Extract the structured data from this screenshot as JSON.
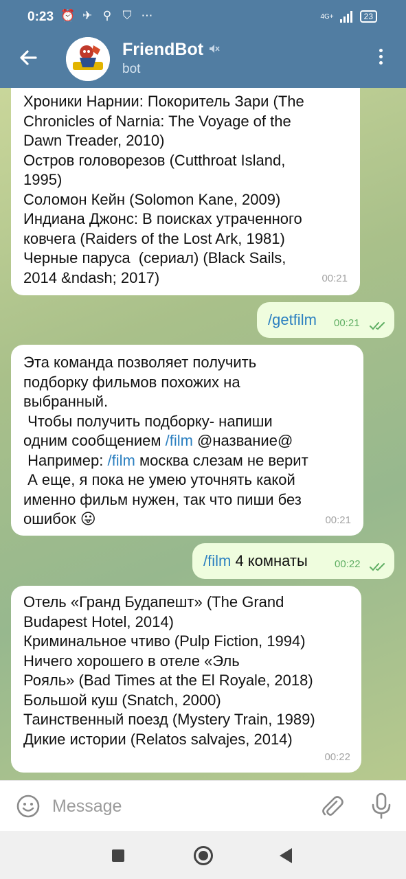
{
  "status": {
    "time": "0:23",
    "network": "4G+",
    "battery": "23"
  },
  "header": {
    "title": "FriendBot",
    "subtitle": "bot"
  },
  "messages": [
    {
      "dir": "in",
      "text": "Хроники Нарнии: Покоритель Зари (The\nChronicles of Narnia: The Voyage of the\nDawn Treader, 2010)\nОстров головорезов (Cutthroat Island,\n1995)\nСоломон Кейн (Solomon Kane, 2009)\nИндиана Джонс: В поисках утраченного\nковчега (Raiders of the Lost Ark, 1981)\nЧерные паруса  (сериал) (Black Sails,\n2014 &ndash; 2017)",
      "time": "00:21"
    },
    {
      "dir": "out",
      "command": "/getfilm",
      "text": "",
      "time": "00:21"
    },
    {
      "dir": "in",
      "line1": "Эта команда позволяет получить\nподборку фильмов похожих на\nвыбранный.\n Чтобы получить подборку- напиши\nодним сообщением ",
      "cmd1": "/film",
      "line2": " @название@\n Например: ",
      "cmd2": "/film",
      "line3": " москва слезам не верит\n А еще, я пока не умею уточнять какой\nименно фильм нужен, так что пиши без\nошибок 😛",
      "time": "00:21"
    },
    {
      "dir": "out",
      "command": "/film",
      "text": " 4 комнаты",
      "time": "00:22"
    },
    {
      "dir": "in",
      "text": "Отель «Гранд Будапешт» (The Grand\nBudapest Hotel, 2014)\nКриминальное чтиво (Pulp Fiction, 1994)\nНичего хорошего в отеле «Эль\nРояль» (Bad Times at the El Royale, 2018)\nБольшой куш (Snatch, 2000)\nТаинственный поезд (Mystery Train, 1989)\nДикие истории (Relatos salvajes, 2014)",
      "time": "00:22"
    }
  ],
  "input": {
    "placeholder": "Message"
  },
  "colors": {
    "header": "#517da2",
    "outgoing": "#effdde",
    "incoming": "#ffffff",
    "link": "#2b7fc0",
    "check": "#5fae63"
  },
  "icons": [
    "back-arrow-icon",
    "mute-icon",
    "more-vertical-icon",
    "emoji-icon",
    "paperclip-icon",
    "microphone-icon",
    "double-check-icon"
  ]
}
